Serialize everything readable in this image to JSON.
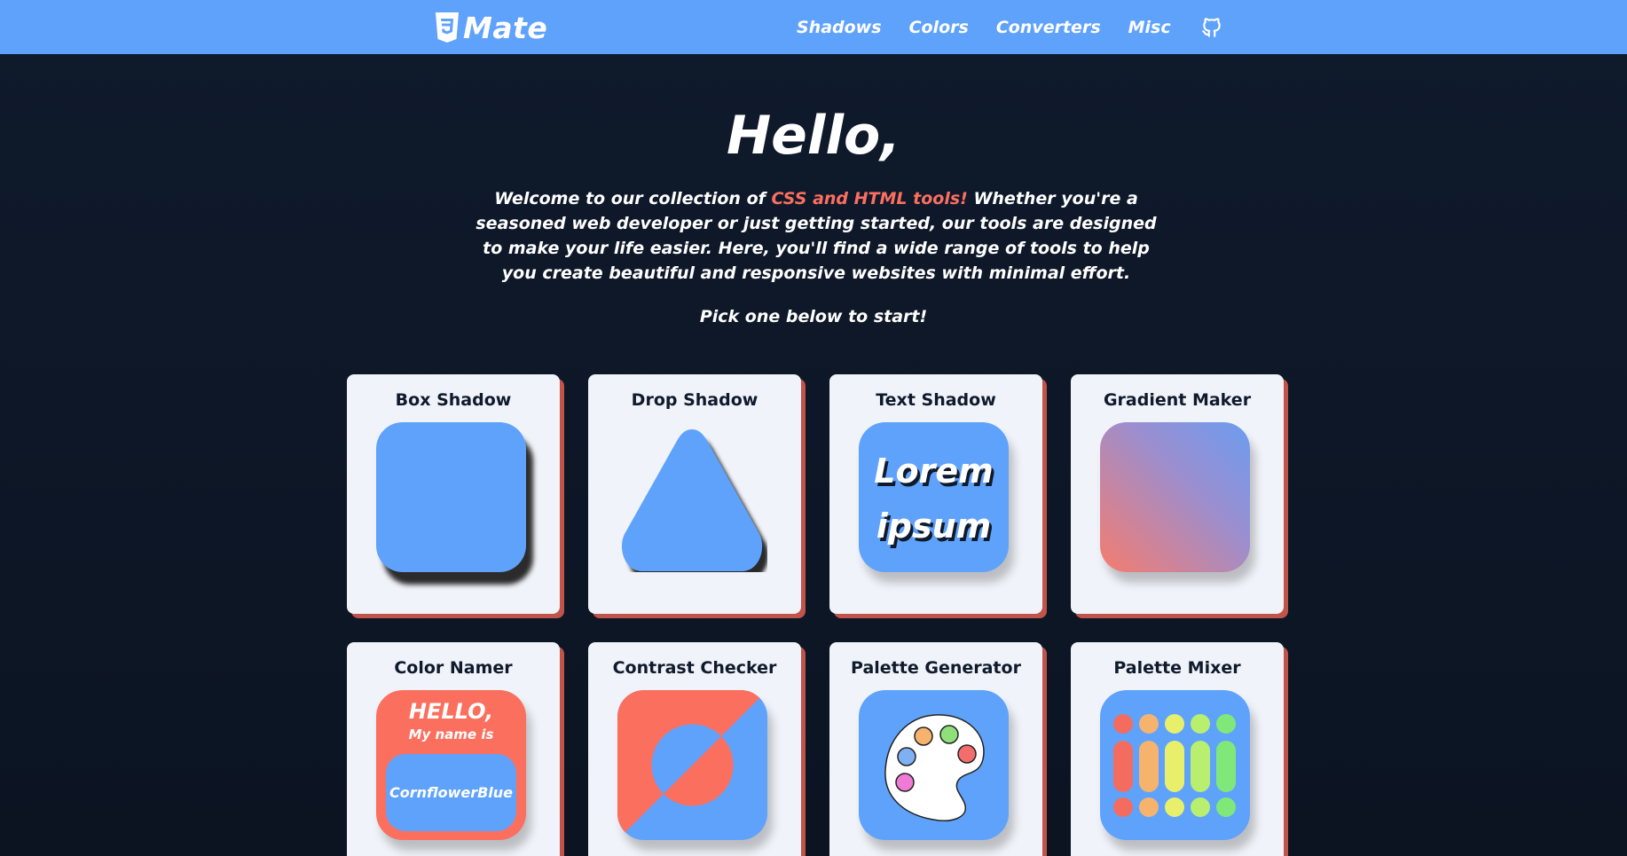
{
  "colors": {
    "navbar": "#5fa2fc",
    "background": "#0f1a2c",
    "accent": "#fb6f5f",
    "card": "#f0f3f9",
    "card_shadow": "#c0544a",
    "blue": "#5fa2fc"
  },
  "nav": {
    "logo_text": "Mate",
    "logo_icon": "css3-icon",
    "links": [
      "Shadows",
      "Colors",
      "Converters",
      "Misc"
    ],
    "github_icon": "github-icon"
  },
  "hero": {
    "title": "Hello,",
    "intro_before": "Welcome to our collection of ",
    "intro_accent": "CSS and HTML tools!",
    "intro_after": " Whether you're a seasoned web developer or just getting started, our tools are designed to make your life easier. Here, you'll find a wide range of tools to help you create beautiful and responsive websites with minimal effort.",
    "pick": "Pick one below to start!"
  },
  "cards": [
    {
      "title": "Box Shadow"
    },
    {
      "title": "Drop Shadow"
    },
    {
      "title": "Text Shadow",
      "preview_line1": "Lorem",
      "preview_line2": "ipsum"
    },
    {
      "title": "Gradient Maker"
    },
    {
      "title": "Color Namer",
      "preview_hello": "HELLO,",
      "preview_my": "My name is",
      "preview_name_line1": "Cornflower",
      "preview_name_line2": "Blue"
    },
    {
      "title": "Contrast Checker"
    },
    {
      "title": "Palette Generator"
    },
    {
      "title": "Palette Mixer"
    }
  ]
}
